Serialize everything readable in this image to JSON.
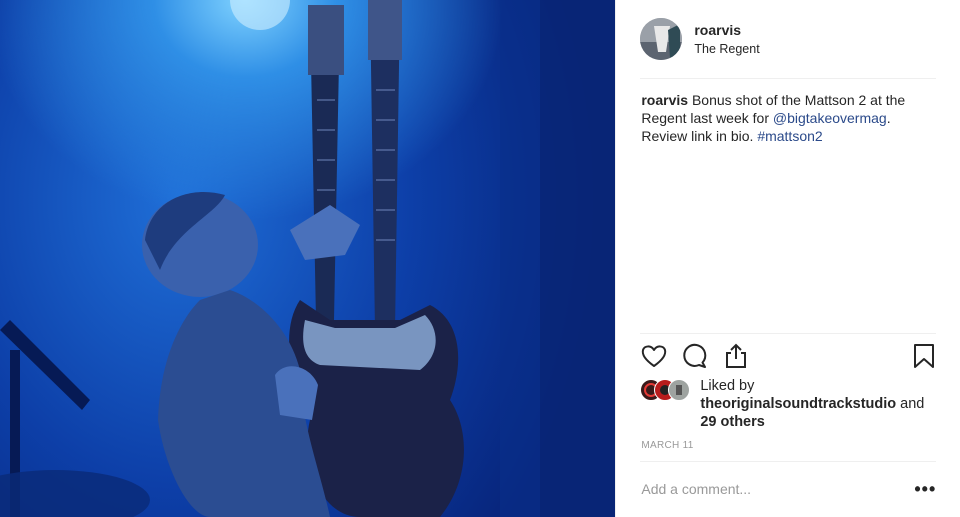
{
  "post": {
    "username": "roarvis",
    "location": "The Regent",
    "caption": {
      "username": "roarvis",
      "text_1": "Bonus shot of the Mattson 2 at the Regent last week for",
      "mention": "@bigtakeovermag",
      "text_2": ". Review link in bio.",
      "hashtag": "#mattson2"
    },
    "likes": {
      "prefix": "Liked by",
      "user": "theoriginalsoundtrackstudio",
      "and": "and",
      "others": "29 others"
    },
    "date": "MARCH 11",
    "comment_placeholder": "Add a comment...",
    "more_label": "•••"
  },
  "icons": {
    "like": "heart-icon",
    "comment": "comment-icon",
    "share": "share-icon",
    "save": "bookmark-icon"
  },
  "colors": {
    "link": "#2b4a8a",
    "text": "#262626",
    "muted": "#999999",
    "photo_blue": "#0d3fa8"
  }
}
